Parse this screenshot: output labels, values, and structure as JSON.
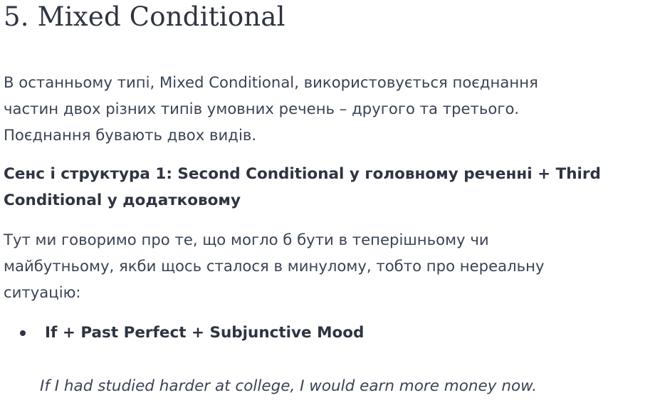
{
  "heading": "5. Mixed Conditional",
  "intro": {
    "line1": "В останньому типі, Mixed Conditional, використовується поєднання",
    "line2": "частин двох різних типів умовних речень – другого та третього.",
    "line3": "Поєднання бувають двох видів."
  },
  "subheading": {
    "line1": "Сенс і структура 1: Second Conditional у головному реченні + Third",
    "line2": "Conditional у додатковому"
  },
  "explanation": {
    "line1": "Тут ми говоримо про те, що могло б бути в теперішньому чи",
    "line2": "майбутньому, якби щось сталося в минулому, тобто про нереальну",
    "line3": "ситуацію:"
  },
  "bullets": [
    "If + Past Perfect + Subjunctive Mood"
  ],
  "example": "If I had studied harder at college, I would earn more money now."
}
